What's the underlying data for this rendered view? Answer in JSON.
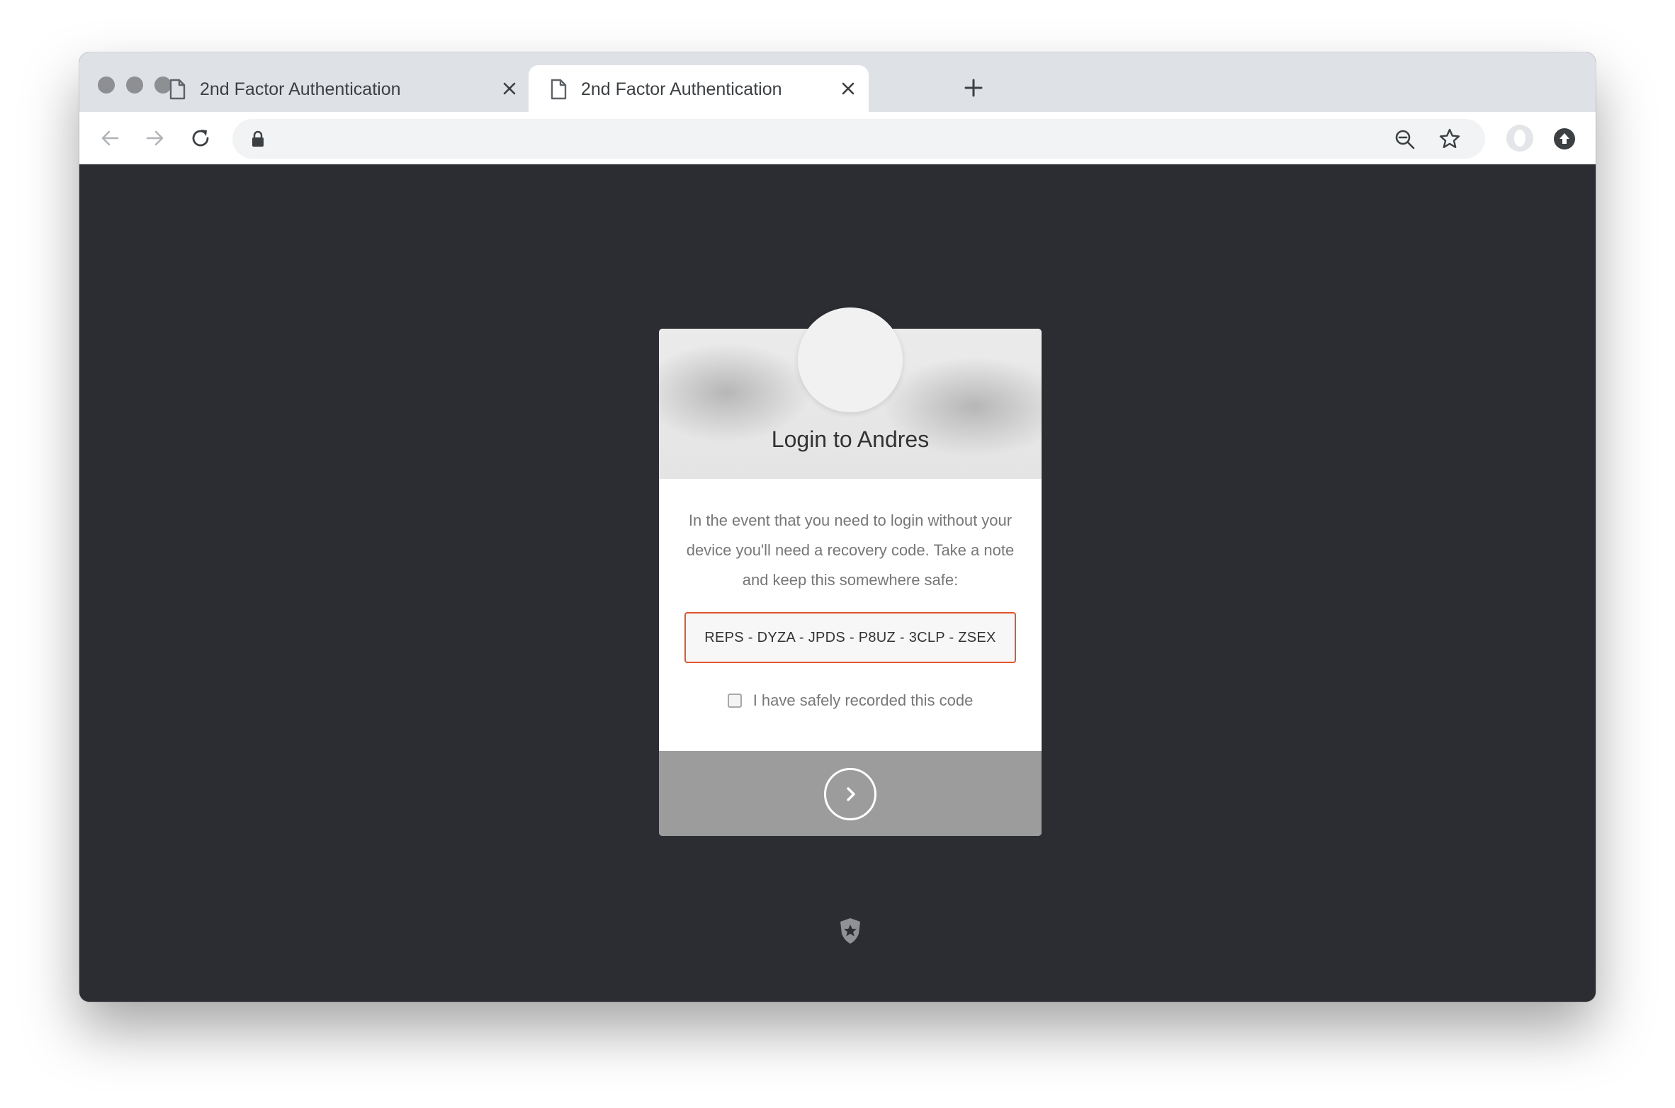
{
  "browser": {
    "tabs": [
      {
        "title": "2nd Factor Authentication",
        "active": false
      },
      {
        "title": "2nd Factor Authentication",
        "active": true
      }
    ],
    "address": ""
  },
  "login": {
    "title": "Login to Andres",
    "instructions": "In the event that you need to login without your device you'll need a recovery code. Take a note and keep this somewhere safe:",
    "recovery_code": "REPS - DYZA - JPDS - P8UZ - 3CLP - ZSEX",
    "confirm_label": "I have safely recorded this code",
    "code_border_color": "#e2562d",
    "footer_color": "#9c9c9c"
  },
  "icons": {
    "tab_icon": "document-icon",
    "submit": "chevron-right-icon",
    "brand": "auth0-shield-icon"
  }
}
